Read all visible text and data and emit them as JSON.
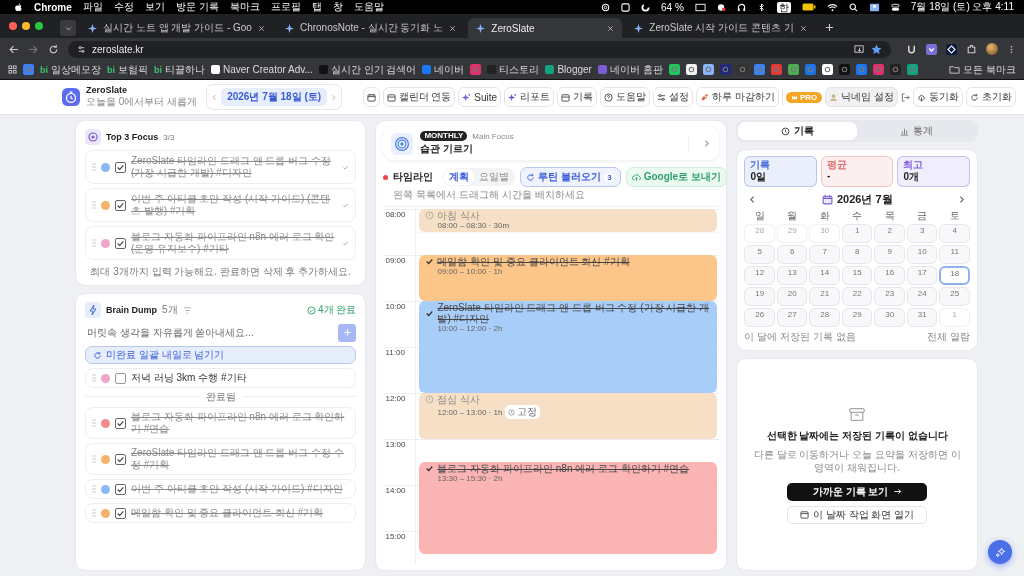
{
  "menubar": {
    "app": "Chrome",
    "menus": [
      "파일",
      "수정",
      "보기",
      "방문 기록",
      "북마크",
      "프로필",
      "탭",
      "창",
      "도움말"
    ],
    "battery": "64 %",
    "input_source": "한",
    "clock": "7월 18일 (토) 오후 4:11"
  },
  "tabs": [
    {
      "title": "실시간 노트 앱 개발 가이드 - Goo",
      "selected": false
    },
    {
      "title": "ChronosNote - 실시간 동기화 노",
      "selected": false
    },
    {
      "title": "ZeroSlate",
      "selected": true
    },
    {
      "title": "ZeroSlate 시작 가이드 콘텐츠 기",
      "selected": false
    }
  ],
  "address": {
    "url": "zeroslate.kr"
  },
  "bookmarks": [
    {
      "kind": "icon"
    },
    {
      "kind": "link",
      "badge": "bi",
      "label": "일상메모장"
    },
    {
      "kind": "link",
      "badge": "bi",
      "label": "보험픽"
    },
    {
      "kind": "link",
      "badge": "bi",
      "label": "티끌하나"
    },
    {
      "kind": "link",
      "label": "Naver Creator Adv..."
    },
    {
      "kind": "link",
      "label": "실시간 인기 검색어"
    },
    {
      "kind": "link",
      "label": "네이버"
    },
    {
      "kind": "icon"
    },
    {
      "kind": "link",
      "label": "티스토리"
    },
    {
      "kind": "link",
      "label": "Blogger"
    },
    {
      "kind": "link",
      "label": "네이버 홈판"
    },
    {
      "kind": "icon"
    },
    {
      "kind": "icon"
    },
    {
      "kind": "icon"
    },
    {
      "kind": "icon"
    },
    {
      "kind": "icon"
    },
    {
      "kind": "icon"
    },
    {
      "kind": "icon"
    },
    {
      "kind": "icon"
    },
    {
      "kind": "icon"
    },
    {
      "kind": "icon"
    },
    {
      "kind": "icon"
    },
    {
      "kind": "icon"
    },
    {
      "kind": "icon"
    },
    {
      "kind": "icon"
    },
    {
      "kind": "icon"
    }
  ],
  "all_bookmarks": "모든 북마크",
  "header": {
    "name": "ZeroSlate",
    "tagline": "오늘을 0에서부터 새롭게",
    "date": "2026년 7월 18일 (토)",
    "buttons": [
      "캘린더 연동",
      "Suite",
      "리포트",
      "기록",
      "도움말",
      "설정",
      "하루 마감하기"
    ],
    "pro": "PRO",
    "nickname": "닉네임 설정",
    "sync": "동기화",
    "reset": "초기화"
  },
  "top3": {
    "title": "Top 3 Focus",
    "count": "3/3",
    "items": [
      {
        "text": "ZeroSlate 타임라인 드래그 앤 드롭 버그 수정 (가장 시급한 개발) #디자인",
        "color": "#8ab8f5",
        "checked": true
      },
      {
        "text": "이번 주 아티클 초안 작성 (시작 가이드) (콘텐츠 발행) #기획",
        "color": "#f6b26b",
        "checked": true
      },
      {
        "text": "블로그 자동화 파이프라인 n8n 에러 로그 확인 (운영 유지보수) #기타",
        "color": "#f0a6c9",
        "checked": true
      }
    ],
    "note": "최대 3개까지 입력 가능해요. 완료하면 삭제 후 추가하세요."
  },
  "brain_dump": {
    "title": "Brain Dump",
    "count": "5개",
    "done_count": "4개 완료",
    "placeholder": "머릿속 생각을 자유롭게 쏟아내세요...",
    "defer_button": "미완료 일괄 내일로 넘기기",
    "items": [
      {
        "text": "저녁 러닝 3km 수행 #기타",
        "color": "#f0a6c9",
        "checked": false
      }
    ],
    "done_header": "완료됨",
    "done_items": [
      {
        "text": "블로그 자동화 파이프라인 n8n 에러 로그 확인하기 #연습",
        "color": "#f28b8b",
        "checked": true
      },
      {
        "text": "ZeroSlate 타임라인 드래그 앤 드롭 버그 수정 수정 #기획",
        "color": "#f6b26b",
        "checked": true
      },
      {
        "text": "이번 주 아티클 초안 작성 (시작 가이드) #디자인",
        "color": "#8ab8f5",
        "checked": true
      },
      {
        "text": "메일함 확인 및 중요 클라이언트 회신 #기획",
        "color": "#f6b26b",
        "checked": true
      }
    ]
  },
  "main_focus": {
    "badge": "MONTHLY",
    "label": "Main Focus",
    "title": "습관 기르기"
  },
  "timeline": {
    "title": "타임라인",
    "hint": "왼쪽 목록에서 드래그해 시간을 배치하세요",
    "views": [
      {
        "label": "계획",
        "selected": true
      },
      {
        "label": "요일별",
        "selected": false
      }
    ],
    "routine_button": "루틴 불러오기",
    "routine_count": "3",
    "google_button": "Google로 보내기",
    "hours": [
      "08:00",
      "09:00",
      "10:00",
      "11:00",
      "12:00",
      "13:00",
      "14:00",
      "15:00"
    ],
    "events": [
      {
        "title": "아침 식사",
        "time": "08:00 – 08:30 · 30m",
        "color": "#f7dfc6",
        "done": false
      },
      {
        "title": "메일함 확인 및 중요 클라이언트 회신 #기획",
        "time": "09:00 – 10:00 · 1h",
        "color": "#fcc68a",
        "done": true
      },
      {
        "title": "ZeroSlate 타임라인 드래그 앤 드롭 버그 수정 (가장 시급한 개발) #디자인",
        "time": "10:00 – 12:00 · 2h",
        "color": "#a8cdf8",
        "done": true
      },
      {
        "title": "점심 식사",
        "time": "12:00 – 13:00 · 1h",
        "color": "#f7dfc6",
        "done": false,
        "badge": "고정"
      },
      {
        "title": "블로그 자동화 파이프라인 n8n 에러 로그 확인하기 #연습",
        "time": "13:30 – 15:30 · 2h",
        "color": "#fbb4b4",
        "done": true
      }
    ]
  },
  "records": {
    "tabs": [
      {
        "label": "기록",
        "selected": true
      },
      {
        "label": "통계",
        "selected": false
      }
    ],
    "stats": [
      {
        "label": "기록",
        "value": "0일",
        "color": "#4a6fd8"
      },
      {
        "label": "평균",
        "value": "-",
        "color": "#e07070"
      },
      {
        "label": "최고",
        "value": "0개",
        "color": "#7a5be0"
      }
    ],
    "calendar": {
      "month": "2026년 7월",
      "weekdays": [
        "일",
        "월",
        "화",
        "수",
        "목",
        "금",
        "토"
      ],
      "days": [
        {
          "day": "28",
          "muted": true,
          "selected": false
        },
        {
          "day": "29",
          "muted": true,
          "selected": false
        },
        {
          "day": "30",
          "muted": true,
          "selected": false
        },
        {
          "day": "1",
          "muted": false,
          "selected": false
        },
        {
          "day": "2",
          "muted": false,
          "selected": false
        },
        {
          "day": "3",
          "muted": false,
          "selected": false
        },
        {
          "day": "4",
          "muted": false,
          "selected": false
        },
        {
          "day": "5",
          "muted": false,
          "selected": false
        },
        {
          "day": "6",
          "muted": false,
          "selected": false
        },
        {
          "day": "7",
          "muted": false,
          "selected": false
        },
        {
          "day": "8",
          "muted": false,
          "selected": false
        },
        {
          "day": "9",
          "muted": false,
          "selected": false
        },
        {
          "day": "10",
          "muted": false,
          "selected": false
        },
        {
          "day": "11",
          "muted": false,
          "selected": false
        },
        {
          "day": "12",
          "muted": false,
          "selected": false
        },
        {
          "day": "13",
          "muted": false,
          "selected": false
        },
        {
          "day": "14",
          "muted": false,
          "selected": false
        },
        {
          "day": "15",
          "muted": false,
          "selected": false
        },
        {
          "day": "16",
          "muted": false,
          "selected": false
        },
        {
          "day": "17",
          "muted": false,
          "selected": false
        },
        {
          "day": "18",
          "muted": false,
          "selected": true
        },
        {
          "day": "19",
          "muted": false,
          "selected": false
        },
        {
          "day": "20",
          "muted": false,
          "selected": false
        },
        {
          "day": "21",
          "muted": false,
          "selected": false
        },
        {
          "day": "22",
          "muted": false,
          "selected": false
        },
        {
          "day": "23",
          "muted": false,
          "selected": false
        },
        {
          "day": "24",
          "muted": false,
          "selected": false
        },
        {
          "day": "25",
          "muted": false,
          "selected": false
        },
        {
          "day": "26",
          "muted": false,
          "selected": false
        },
        {
          "day": "27",
          "muted": false,
          "selected": false
        },
        {
          "day": "28",
          "muted": false,
          "selected": false
        },
        {
          "day": "29",
          "muted": false,
          "selected": false
        },
        {
          "day": "30",
          "muted": false,
          "selected": false
        },
        {
          "day": "31",
          "muted": false,
          "selected": false
        },
        {
          "day": "1",
          "muted": true,
          "selected": false
        }
      ],
      "footer": "이 달에 저장된 기록 없음",
      "view_all": "전체 열람"
    },
    "empty": {
      "title": "선택한 날짜에는 저장된 기록이 없습니다",
      "body": "다른 달로 이동하거나 오늘 요약을 저장하면 이 영역이 채워집니다.",
      "primary": "가까운 기록 보기",
      "secondary": "이 날짜 작업 화면 열기"
    }
  }
}
